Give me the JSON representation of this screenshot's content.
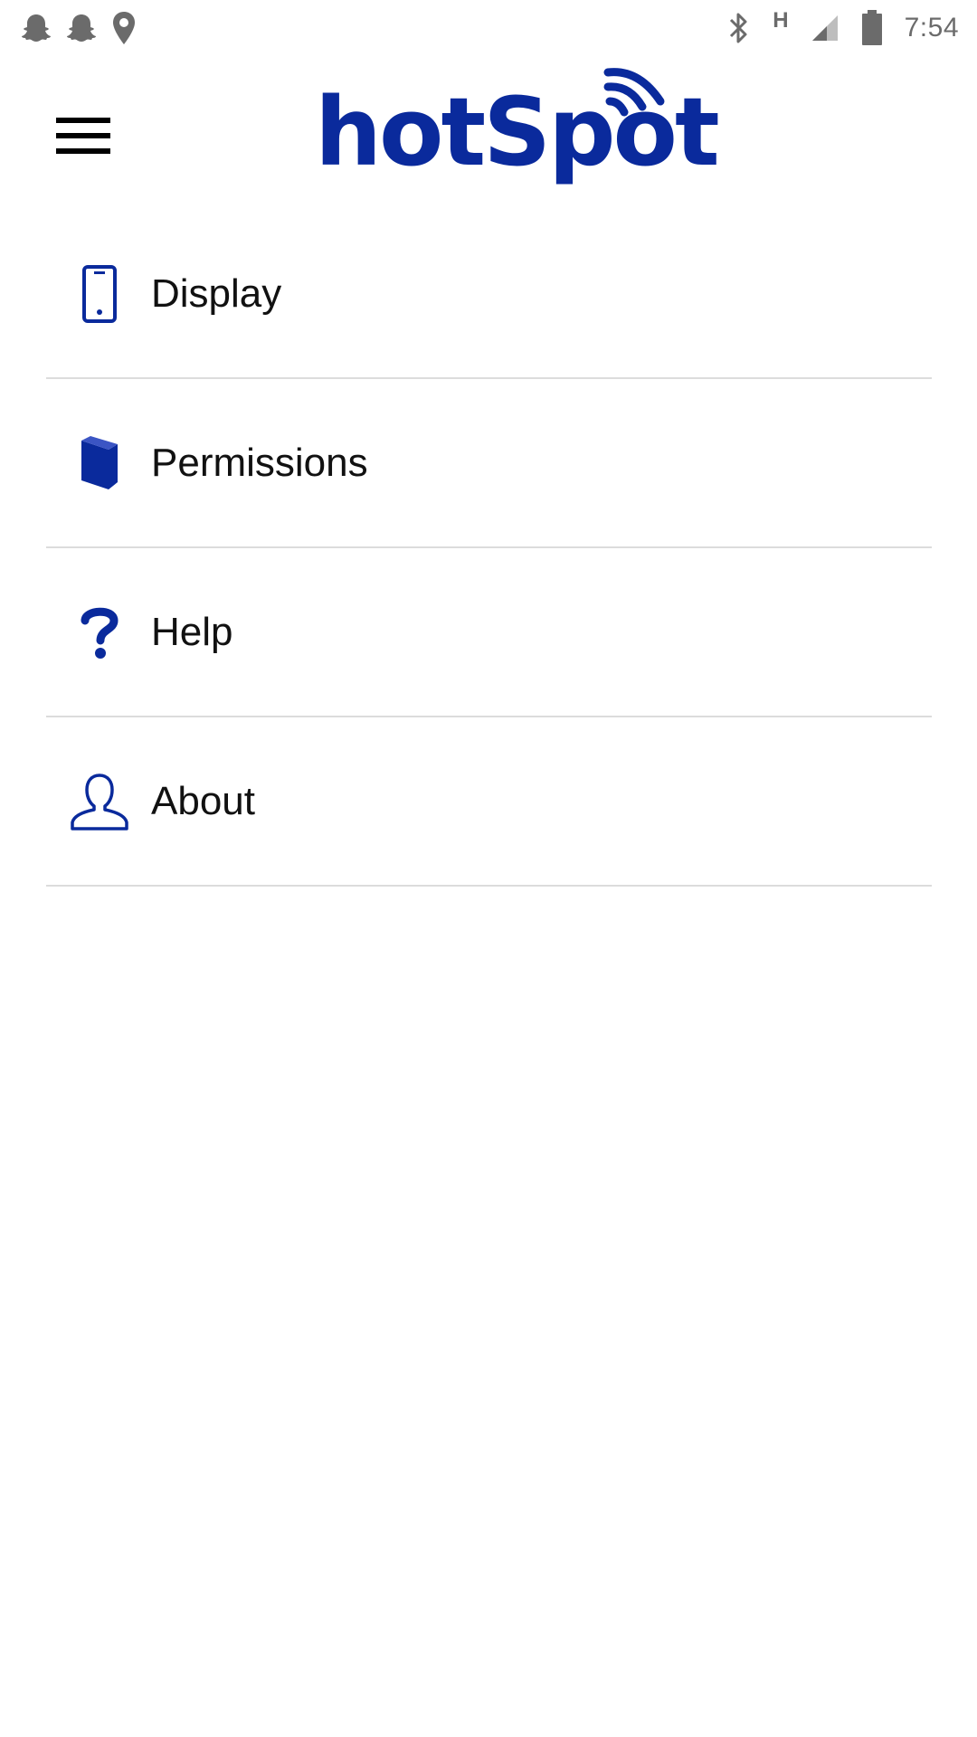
{
  "status_bar": {
    "left_icons": [
      "snapchat-ghost-icon",
      "snapchat-ghost-icon",
      "location-pin-icon"
    ],
    "right_icons": [
      "bluetooth-icon",
      "network-h-icon",
      "cell-signal-icon",
      "battery-icon"
    ],
    "network_type": "H",
    "time": "7:54"
  },
  "app_bar": {
    "menu_icon": "hamburger-menu-icon",
    "logo_text": "hotSpot",
    "logo_icon": "wifi-waves-icon"
  },
  "menu": {
    "items": [
      {
        "label": "Display",
        "icon": "phone-icon"
      },
      {
        "label": "Permissions",
        "icon": "book-icon"
      },
      {
        "label": "Help",
        "icon": "question-mark-icon"
      },
      {
        "label": "About",
        "icon": "user-outline-icon"
      }
    ]
  },
  "colors": {
    "brand": "#0a2a9c",
    "divider": "#dcdcdc",
    "status_icon": "#6b6b6b",
    "text": "#111111"
  }
}
